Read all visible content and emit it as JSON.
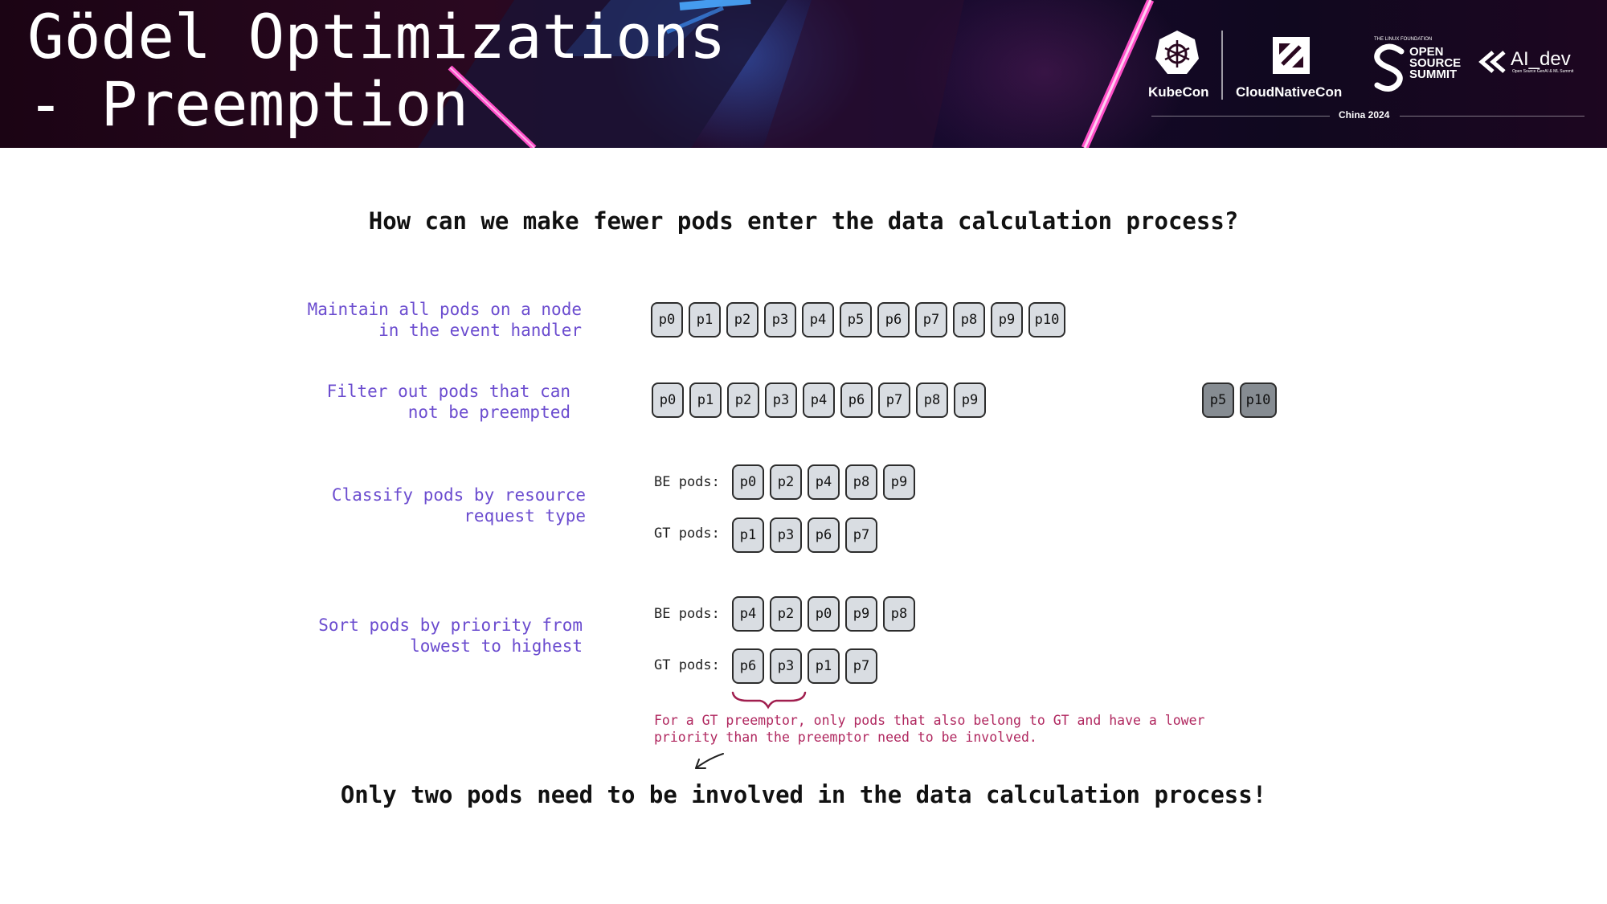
{
  "header": {
    "title_line1": "Gödel Optimizations",
    "title_line2": "- Preemption",
    "logos": {
      "kubecon": "KubeCon",
      "cloudnativecon": "CloudNativeCon",
      "linux_foundation": "THE LINUX FOUNDATION",
      "oss_line1": "OPEN",
      "oss_line2": "SOURCE",
      "oss_line3": "SUMMIT",
      "ai_dev": "AI_dev",
      "ai_dev_sub": "Open Source GenAI & ML Summit",
      "event": "China 2024"
    }
  },
  "question": "How can we make fewer pods enter the data calculation process?",
  "steps": [
    {
      "label": "Maintain all pods on a node\nin the event handler",
      "pods": [
        "p0",
        "p1",
        "p2",
        "p3",
        "p4",
        "p5",
        "p6",
        "p7",
        "p8",
        "p9",
        "p10"
      ]
    },
    {
      "label": "Filter out pods that can\nnot be preempted",
      "pods": [
        "p0",
        "p1",
        "p2",
        "p3",
        "p4",
        "p6",
        "p7",
        "p8",
        "p9"
      ],
      "filtered_pods": [
        "p5",
        "p10"
      ]
    },
    {
      "label": "Classify pods by resource\nrequest type",
      "groups": [
        {
          "name": "BE pods:",
          "pods": [
            "p0",
            "p2",
            "p4",
            "p8",
            "p9"
          ]
        },
        {
          "name": "GT pods:",
          "pods": [
            "p1",
            "p3",
            "p6",
            "p7"
          ]
        }
      ]
    },
    {
      "label": "Sort pods by priority from\nlowest to highest",
      "groups": [
        {
          "name": "BE pods:",
          "pods": [
            "p4",
            "p2",
            "p0",
            "p9",
            "p8"
          ]
        },
        {
          "name": "GT pods:",
          "pods": [
            "p6",
            "p3",
            "p1",
            "p7"
          ]
        }
      ]
    }
  ],
  "note": "For a GT preemptor, only pods that also belong to GT and have a lower priority than the preemptor need to be involved.",
  "conclusion": "Only two pods need to be involved in the data calculation process!",
  "colors": {
    "step_label": "#6b4ccf",
    "note": "#b0275f",
    "pod_fill": "#d9dde2",
    "pod_filtered_fill": "#868c92"
  }
}
